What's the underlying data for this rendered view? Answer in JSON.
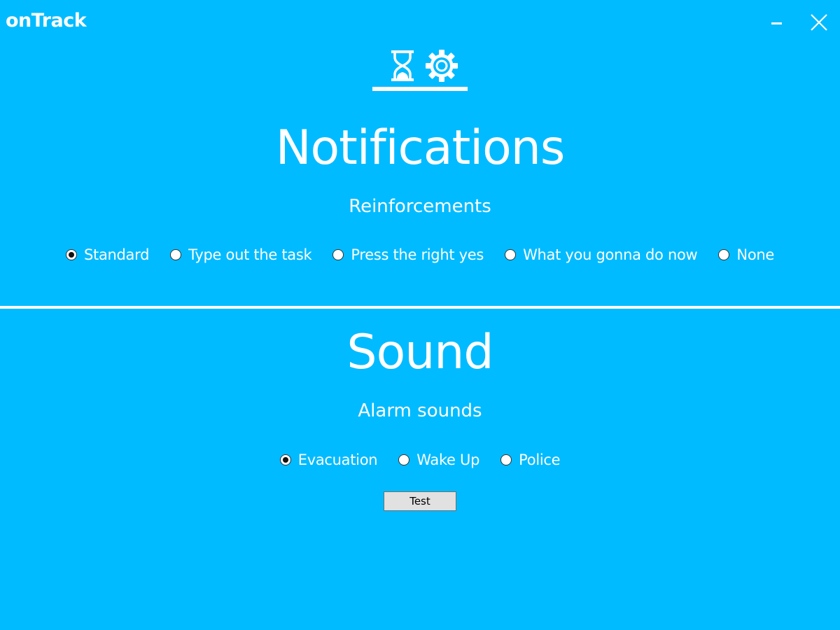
{
  "app": {
    "title": "onTrack"
  },
  "window_controls": {
    "minimize_icon": "minimize-icon",
    "close_icon": "close-icon"
  },
  "tabs": [
    {
      "icon": "hourglass-icon",
      "selected": false
    },
    {
      "icon": "gear-icon",
      "selected": true
    }
  ],
  "notifications": {
    "title": "Notifications",
    "subtitle": "Reinforcements",
    "options": [
      {
        "label": "Standard",
        "checked": true
      },
      {
        "label": "Type out the task",
        "checked": false
      },
      {
        "label": "Press the right yes",
        "checked": false
      },
      {
        "label": "What you gonna do now",
        "checked": false
      },
      {
        "label": "None",
        "checked": false
      }
    ]
  },
  "sound": {
    "title": "Sound",
    "subtitle": "Alarm sounds",
    "options": [
      {
        "label": "Evacuation",
        "checked": true
      },
      {
        "label": "Wake Up",
        "checked": false
      },
      {
        "label": "Police",
        "checked": false
      }
    ],
    "test_label": "Test"
  },
  "colors": {
    "background": "#00BBFF",
    "foreground": "#FFFFFF",
    "button_bg": "#E1E1E1"
  }
}
